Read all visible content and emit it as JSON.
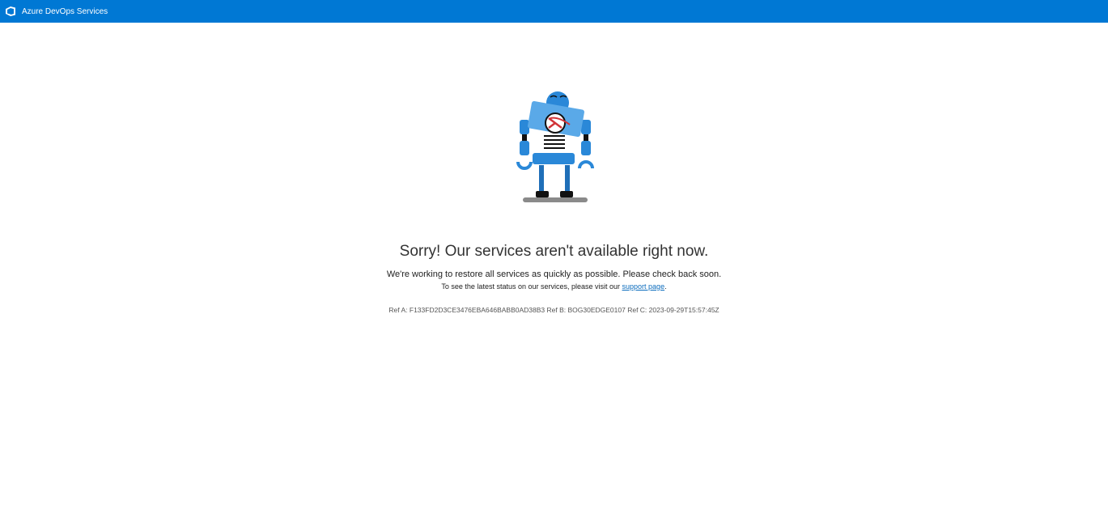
{
  "header": {
    "brand": "Azure DevOps Services",
    "logo_icon": "azure-devops-logo-icon",
    "bg_color": "#0078d4"
  },
  "illustration": {
    "name": "sad-robot-illustration"
  },
  "main": {
    "headline": "Sorry! Our services aren't available right now.",
    "message": "We're working to restore all services as quickly as possible. Please check back soon.",
    "status_prefix": "To see the latest status on our services, please visit our ",
    "support_link": "support page",
    "status_suffix": ".",
    "refs": "Ref A: F133FD2D3CE3476EBA646BABB0AD38B3 Ref B: BOG30EDGE0107 Ref C: 2023-09-29T15:57:45Z"
  },
  "colors": {
    "link": "#0b6cbd",
    "robot_blue": "#2a88d8",
    "robot_light": "#5aa9e8"
  }
}
